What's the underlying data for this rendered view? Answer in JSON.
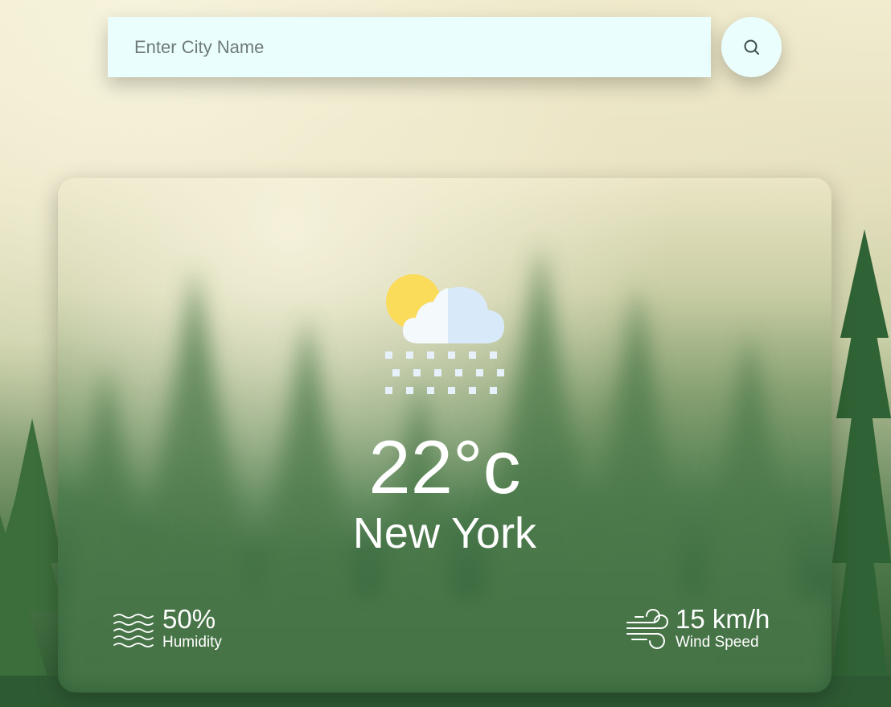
{
  "search": {
    "placeholder": "Enter City Name",
    "value": "",
    "button_icon": "search-icon"
  },
  "weather": {
    "icon": "partly-cloudy-snow-icon",
    "temperature": "22°c",
    "city": "New York",
    "humidity": {
      "icon": "humidity-waves-icon",
      "value": "50%",
      "label": "Humidity"
    },
    "wind": {
      "icon": "wind-icon",
      "value": "15 km/h",
      "label": "Wind Speed"
    }
  },
  "colors": {
    "input_background": "#eafffd",
    "text": "#ffffff",
    "sun": "#fbdb5a",
    "cloud_light": "#f4f9fb",
    "cloud_shade": "#d8eafa"
  }
}
